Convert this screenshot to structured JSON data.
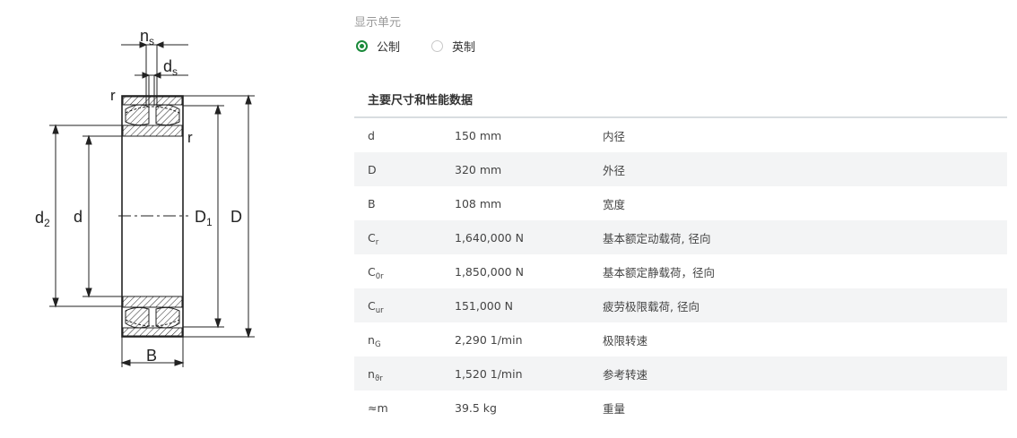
{
  "drawing": {
    "labels": {
      "ns": "n",
      "ns_sub": "s",
      "ds": "d",
      "ds_sub": "s",
      "r_top": "r",
      "r_right": "r",
      "d2": "d",
      "d2_sub": "2",
      "d": "d",
      "D1": "D",
      "D1_sub": "1",
      "D": "D",
      "B": "B"
    }
  },
  "units": {
    "label": "显示单元",
    "options": [
      {
        "label": "公制",
        "selected": true
      },
      {
        "label": "英制",
        "selected": false
      }
    ]
  },
  "section": {
    "title": "主要尺寸和性能数据"
  },
  "specs": [
    {
      "symbol": "d",
      "symbol_sub": "",
      "value": "150 mm",
      "desc": "内径"
    },
    {
      "symbol": "D",
      "symbol_sub": "",
      "value": "320 mm",
      "desc": "外径"
    },
    {
      "symbol": "B",
      "symbol_sub": "",
      "value": "108 mm",
      "desc": "宽度"
    },
    {
      "symbol": "C",
      "symbol_sub": "r",
      "value": "1,640,000 N",
      "desc": "基本额定动载荷, 径向"
    },
    {
      "symbol": "C",
      "symbol_sub": "0r",
      "value": "1,850,000 N",
      "desc": "基本额定静载荷，径向"
    },
    {
      "symbol": "C",
      "symbol_sub": "ur",
      "value": "151,000 N",
      "desc": "疲劳极限载荷, 径向"
    },
    {
      "symbol": "n",
      "symbol_sub": "G",
      "value": "2,290 1/min",
      "desc": "极限转速"
    },
    {
      "symbol": "n",
      "symbol_sub": "ϑr",
      "value": "1,520 1/min",
      "desc": "参考转速"
    },
    {
      "symbol": "≈m",
      "symbol_sub": "",
      "value": "39.5 kg",
      "desc": "重量"
    }
  ]
}
